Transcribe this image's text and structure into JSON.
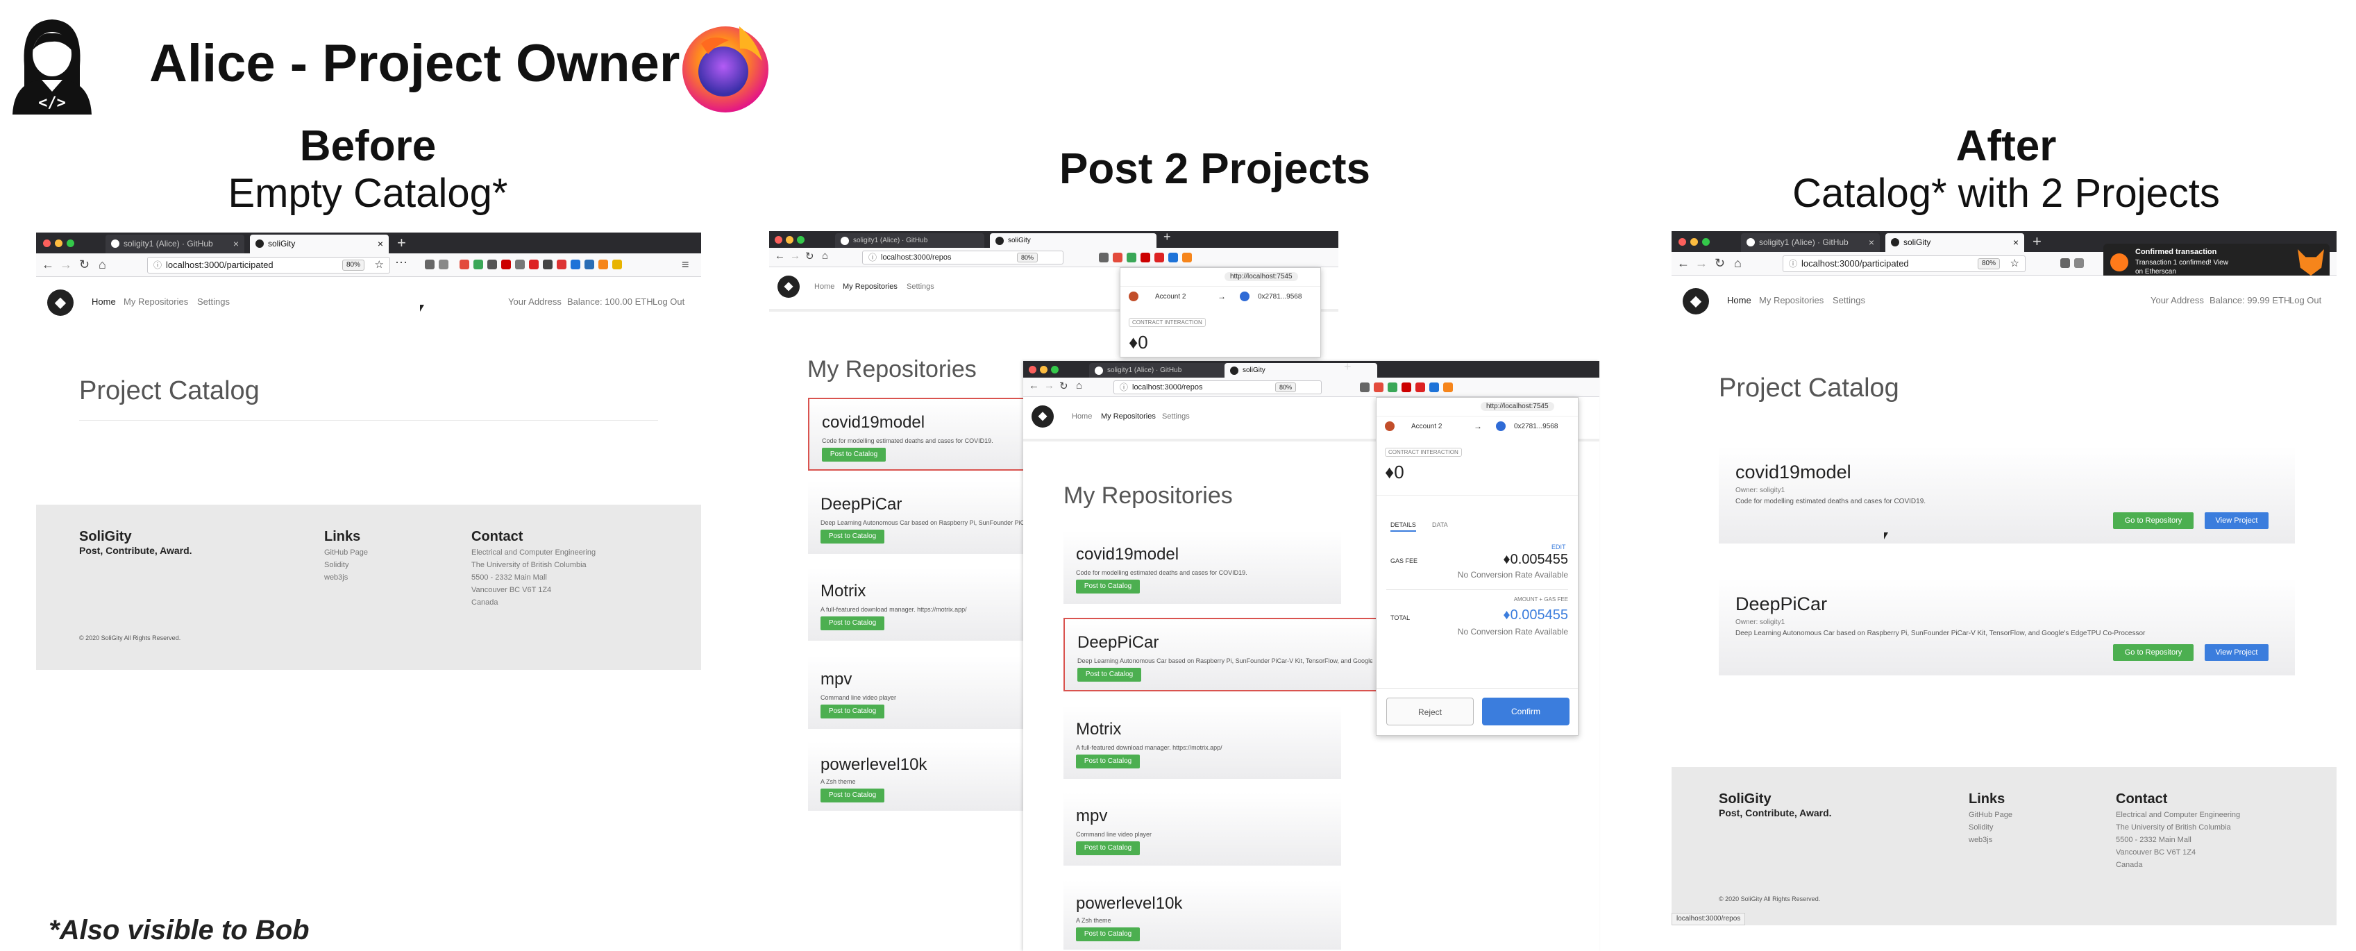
{
  "heading": {
    "title": "Alice - Project Owner",
    "footnote": "*Also visible to Bob",
    "avatar_icon": "woman-developer-icon",
    "firefox_icon": "firefox-logo-icon"
  },
  "columns": [
    {
      "title": "Before",
      "subtitle": "Empty Catalog*"
    },
    {
      "title": "Post 2 Projects",
      "subtitle": ""
    },
    {
      "title": "After",
      "subtitle": "Catalog* with 2 Projects"
    }
  ],
  "browser": {
    "tab_github": "soligity1 (Alice) · GitHub",
    "tab_site": "soliGity",
    "zoom": "80%"
  },
  "urls": {
    "participated": "localhost:3000/participated",
    "repos": "localhost:3000/repos",
    "status_bar": "localhost:3000/repos"
  },
  "site_nav": {
    "home": "Home",
    "repos": "My Repositories",
    "settings": "Settings",
    "address": "Your Address",
    "balance_before": "Balance: 100.00 ETH",
    "balance_after": "Balance: 99.99 ETH",
    "logout": "Log Out"
  },
  "catalog": {
    "title": "Project Catalog",
    "owner": "Owner: soligity1",
    "go_repo": "Go to Repository",
    "view_project": "View Project",
    "projects": [
      {
        "name": "covid19model",
        "desc": "Code for modelling estimated deaths and cases for COVID19."
      },
      {
        "name": "DeepPiCar",
        "desc": "Deep Learning Autonomous Car based on Raspberry Pi, SunFounder PiCar-V Kit, TensorFlow, and Google's EdgeTPU Co-Processor"
      }
    ]
  },
  "repos": {
    "title": "My Repositories",
    "post_button": "Post to Catalog",
    "items": [
      {
        "name": "covid19model",
        "desc": "Code for modelling estimated deaths and cases for COVID19."
      },
      {
        "name": "DeepPiCar",
        "desc": "Deep Learning Autonomous Car based on Raspberry Pi, SunFounder PiCar-V Kit, TensorFlow, and Google's EdgeTPU Co-Processor"
      },
      {
        "name": "Motrix",
        "desc": "A full-featured download manager. https://motrix.app/"
      },
      {
        "name": "mpv",
        "desc": "Command line video player"
      },
      {
        "name": "powerlevel10k",
        "desc": "A Zsh theme"
      }
    ]
  },
  "footer": {
    "brand": "SoliGity",
    "tagline": "Post, Contribute, Award.",
    "links_title": "Links",
    "links": [
      "GitHub Page",
      "Solidity",
      "web3js"
    ],
    "contact_title": "Contact",
    "contact": [
      "Electrical and Computer Engineering",
      "The University of British Columbia",
      "5500 - 2332 Main Mall",
      "Vancouver BC V6T 1Z4",
      "Canada"
    ],
    "copyright": "© 2020 SoliGity All Rights Reserved."
  },
  "metamask": {
    "origin": "http://localhost:7545",
    "account": "Account 2",
    "to": "0x2781...9568",
    "badge": "CONTRACT INTERACTION",
    "amount": "0",
    "tab_details": "DETAILS",
    "tab_data": "DATA",
    "edit": "EDIT",
    "gas_label": "GAS FEE",
    "gas_value": "0.005455",
    "no_rate": "No Conversion Rate Available",
    "amount_gas": "AMOUNT + GAS FEE",
    "total_label": "TOTAL",
    "total_value": "0.005455",
    "reject": "Reject",
    "confirm": "Confirm"
  },
  "toast": {
    "title": "Confirmed transaction",
    "line1": "Transaction 1 confirmed! View",
    "line2": "on Etherscan"
  },
  "colors": {
    "post_green": "#4caf50",
    "view_blue": "#3b7ddd",
    "confirm_blue": "#3b7ddd",
    "select_red": "#d9534f"
  }
}
